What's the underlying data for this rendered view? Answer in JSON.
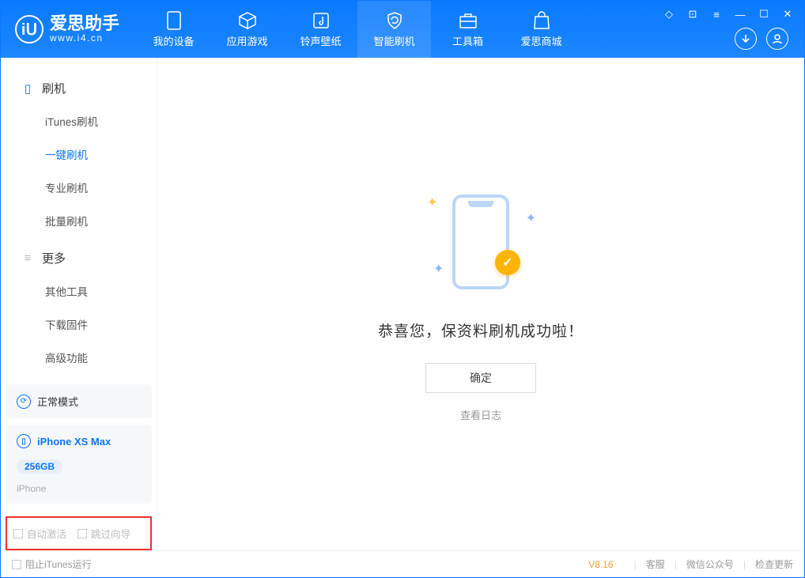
{
  "app": {
    "name_cn": "爱思助手",
    "domain": "www.i4.cn"
  },
  "tabs": {
    "device": "我的设备",
    "apps": "应用游戏",
    "ring": "铃声壁纸",
    "flash": "智能刷机",
    "toolbox": "工具箱",
    "store": "爱思商城"
  },
  "sidebar": {
    "group_flash": "刷机",
    "items_flash": {
      "itunes": "iTunes刷机",
      "oneclick": "一键刷机",
      "pro": "专业刷机",
      "batch": "批量刷机"
    },
    "group_more": "更多",
    "items_more": {
      "other": "其他工具",
      "firmware": "下载固件",
      "advanced": "高级功能"
    },
    "mode_label": "正常模式",
    "device_name": "iPhone XS Max",
    "device_capacity": "256GB",
    "device_type": "iPhone",
    "cb_auto_activate": "自动激活",
    "cb_skip_wizard": "跳过向导"
  },
  "main": {
    "success_msg": "恭喜您，保资料刷机成功啦！",
    "ok_btn": "确定",
    "view_log": "查看日志"
  },
  "footer": {
    "block_itunes": "阻止iTunes运行",
    "version": "V8.16",
    "service": "客服",
    "wechat": "微信公众号",
    "update": "检查更新"
  }
}
